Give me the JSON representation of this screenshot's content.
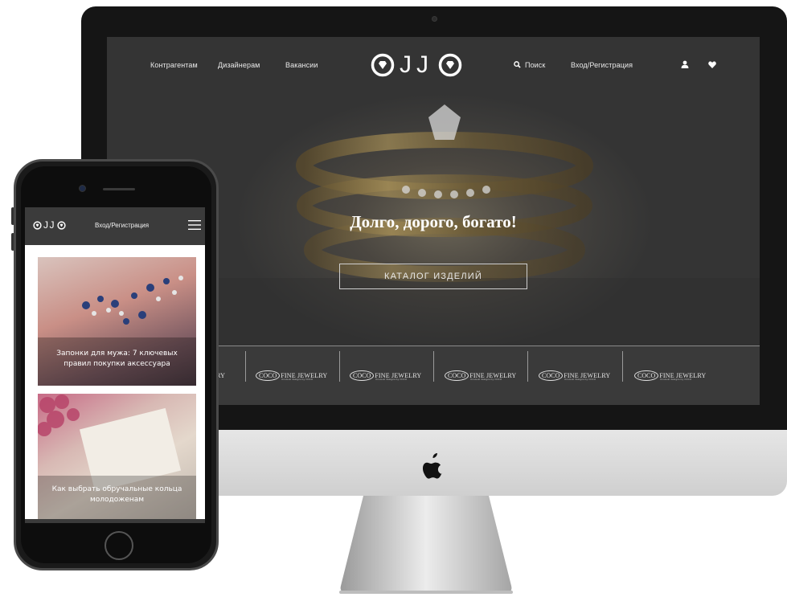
{
  "desktop": {
    "nav": {
      "left_links": [
        "Контрагентам",
        "Дизайнерам",
        "Вакансии"
      ],
      "logo": "JJ",
      "search_label": "Поиск",
      "login_label": "Вход/Регистрация"
    },
    "hero": {
      "title": "Долго, дорого, богато!",
      "button_label": "КАТАЛОГ ИЗДЕЛИЙ"
    },
    "brands": {
      "partial_left": "LRY",
      "items": [
        {
          "mark": "COCO",
          "name": "FINE JEWELRY",
          "sub": "Unusual designs by COCO"
        },
        {
          "mark": "COCO",
          "name": "FINE JEWELRY",
          "sub": "Unusual designs by COCO"
        },
        {
          "mark": "COCO",
          "name": "FINE JEWELRY",
          "sub": "Unusual designs by COCO"
        },
        {
          "mark": "COCO",
          "name": "FINE JEWELRY",
          "sub": "Unusual designs by COCO"
        },
        {
          "mark": "COCO",
          "name": "FINE JEWELRY",
          "sub": "Unusual designs by COCO"
        }
      ]
    }
  },
  "mobile": {
    "logo": "JJ",
    "login_label": "Вход/Регистрация",
    "articles": [
      {
        "caption_line1": "Запонки для мужа: 7 ключевых",
        "caption_line2": "правил покупки аксессуара"
      },
      {
        "caption_line1": "Как выбрать обручальные кольца",
        "caption_line2": "молодоженам"
      }
    ]
  },
  "colors": {
    "nav_bg": "#3b3b3b",
    "hero_text": "#ffffff",
    "gold": "#a08a55"
  },
  "icons": [
    "diamond-icon",
    "search-icon",
    "user-icon",
    "heart-icon",
    "menu-icon",
    "apple-icon"
  ]
}
